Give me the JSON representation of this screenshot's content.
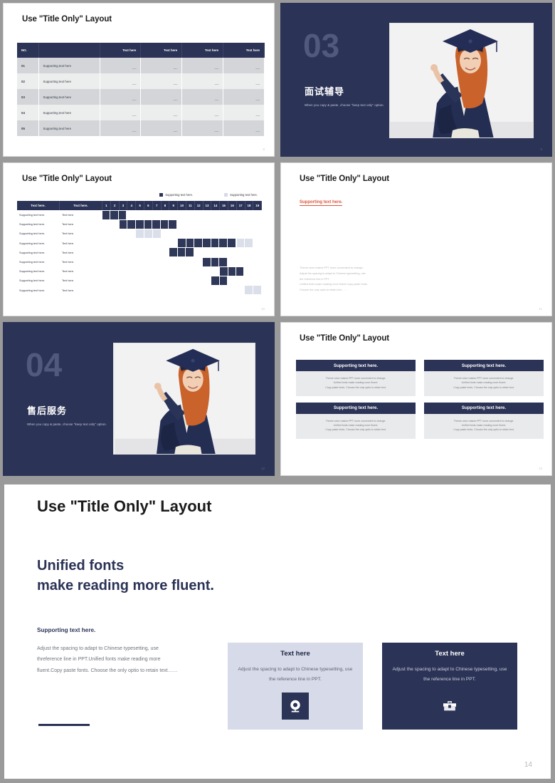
{
  "theme": {
    "navy": "#2b3356",
    "light_navy": "#515a7c",
    "accent_red": "#e0553c",
    "panel_grey": "#e9eaec",
    "light_blue": "#d6dae9"
  },
  "slides": [
    {
      "id": "table-slide",
      "title": "Use \"Title Only\" Layout",
      "page_num": "8",
      "table": {
        "headers": [
          "NO.",
          "",
          "Text here",
          "Text here",
          "Text here",
          "Text here"
        ],
        "rows": [
          {
            "no": "01",
            "desc": "Supporting text here",
            "values": [
              "-----",
              "-----",
              "-----",
              "-----"
            ]
          },
          {
            "no": "02",
            "desc": "Supporting text here",
            "values": [
              "-----",
              "-----",
              "-----",
              "-----"
            ]
          },
          {
            "no": "03",
            "desc": "Supporting text here",
            "values": [
              "-----",
              "-----",
              "-----",
              "-----"
            ]
          },
          {
            "no": "04",
            "desc": "Supporting text here",
            "values": [
              "-----",
              "-----",
              "-----",
              "-----"
            ]
          },
          {
            "no": "05",
            "desc": "Supporting text here",
            "values": [
              "-----",
              "-----",
              "-----",
              "-----"
            ]
          }
        ]
      }
    },
    {
      "id": "section-03",
      "number": "03",
      "title": "面试辅导",
      "subtitle": "When you copy & paste, choose \"keep text only\" option.",
      "page_num": "9",
      "photo_alt": "graduate-woman-pointing"
    },
    {
      "id": "gantt-slide",
      "title": "Use \"Title Only\" Layout",
      "page_num": "10",
      "legend": [
        "Supporting text here.",
        "Supporting text here."
      ]
    },
    {
      "id": "text-slide",
      "title": "Use \"Title Only\" Layout",
      "link": "Supporting text here.",
      "page_num": "11",
      "paragraph_lines": [
        "Theme color makes PPT more convenient to change.",
        "Adjust the spacing to adapt to Chinese typesetting, use",
        "the reference line in PPT.",
        "Unified fonts make reading more fluent.Copy paste fonts.",
        "Choose the only optio to retain text……"
      ]
    },
    {
      "id": "section-04",
      "number": "04",
      "title": "售后服务",
      "subtitle": "When you copy & paste, choose \"keep text only\" option.",
      "page_num": "12",
      "photo_alt": "graduate-woman-pointing"
    },
    {
      "id": "cards-slide",
      "title": "Use \"Title Only\" Layout",
      "page_num": "13",
      "cards": [
        {
          "title": "Supporting text here.",
          "lines": [
            "Theme color makes PPT more convenient to change.",
            "Unified fonts make reading more fluent.",
            "Copy paste fonts. Choose the only optio to retain text."
          ]
        },
        {
          "title": "Supporting text here.",
          "lines": [
            "Theme color makes PPT more convenient to change.",
            "Unified fonts make reading more fluent.",
            "Copy paste fonts. Choose the only optio to retain text."
          ]
        },
        {
          "title": "Supporting text here.",
          "lines": [
            "Theme color makes PPT more convenient to change.",
            "Unified fonts make reading more fluent.",
            "Copy paste fonts. Choose the only optio to retain text."
          ]
        },
        {
          "title": "Supporting text here.",
          "lines": [
            "Theme color makes PPT more convenient to change.",
            "Unified fonts make reading more fluent.",
            "Copy paste fonts. Choose the only optio to retain text."
          ]
        }
      ]
    }
  ],
  "big_slide": {
    "title": "Use \"Title Only\" Layout",
    "headline_line1": "Unified fonts",
    "headline_line2": "make reading more fluent.",
    "subhead": "Supporting text here.",
    "paragraph": "Adjust the spacing to adapt to Chinese typesetting, use threference line in PPT.Unified fonts make reading more fluent.Copy paste fonts. Choose the only optio to retain text……",
    "page_num": "14",
    "cards": [
      {
        "title": "Text here",
        "text": "Adjust the spacing to adapt to Chinese typesetting, use the reference line in PPT.",
        "icon": "webcam-icon"
      },
      {
        "title": "Text here",
        "text": "Adjust the spacing to adapt to Chinese typesetting, use the reference line in PPT.",
        "icon": "toolbox-icon"
      }
    ]
  },
  "chart_data": {
    "type": "bar",
    "title": "Gantt schedule",
    "xlabel": "",
    "ylabel": "",
    "categories": [
      "1",
      "2",
      "3",
      "4",
      "5",
      "6",
      "7",
      "8",
      "9",
      "10",
      "11",
      "12",
      "13",
      "14",
      "15",
      "16",
      "17",
      "18",
      "19"
    ],
    "column_headers": [
      "Text here.",
      "Text here."
    ],
    "legend": [
      "Supporting text here.",
      "Supporting text here."
    ],
    "legend_position": "top-right",
    "grid": false,
    "tasks": [
      {
        "name": "Supporting text here.",
        "sub": "Text here.",
        "start": 1,
        "end": 3,
        "series": "dark"
      },
      {
        "name": "Supporting text here.",
        "sub": "Text here.",
        "start": 3,
        "end": 9,
        "series": "dark"
      },
      {
        "name": "Supporting text here.",
        "sub": "Text here.",
        "start": 5,
        "end": 7,
        "series": "light"
      },
      {
        "name": "Supporting text here.",
        "sub": "Text here.",
        "start": 10,
        "end": 16,
        "series": "dark",
        "extra_start": 17,
        "extra_end": 18,
        "extra_series": "light"
      },
      {
        "name": "Supporting text here.",
        "sub": "Text here.",
        "start": 9,
        "end": 11,
        "series": "dark"
      },
      {
        "name": "Supporting text here.",
        "sub": "Text here.",
        "start": 13,
        "end": 15,
        "series": "dark"
      },
      {
        "name": "Supporting text here.",
        "sub": "Text here.",
        "start": 15,
        "end": 17,
        "series": "dark"
      },
      {
        "name": "Supporting text here.",
        "sub": "Text here.",
        "start": 14,
        "end": 15,
        "series": "dark"
      },
      {
        "name": "Supporting text here.",
        "sub": "Text here.",
        "start": 18,
        "end": 19,
        "series": "light"
      }
    ]
  }
}
